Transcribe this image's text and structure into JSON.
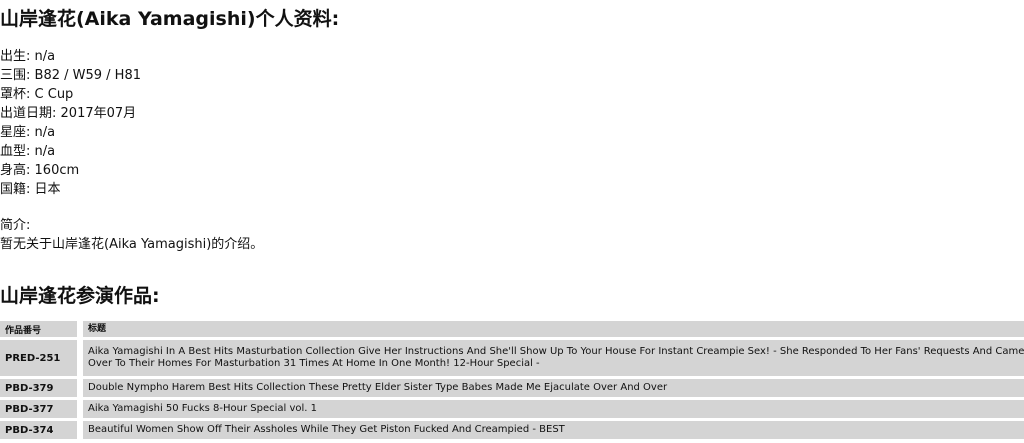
{
  "profile_title": "山岸逢花(Aika Yamagishi)个人资料:",
  "info": [
    {
      "label": "出生:",
      "value": "n/a"
    },
    {
      "label": "三围:",
      "value": "B82 / W59 / H81"
    },
    {
      "label": "罩杯:",
      "value": "C Cup"
    },
    {
      "label": "出道日期:",
      "value": "2017年07月"
    },
    {
      "label": "星座:",
      "value": "n/a"
    },
    {
      "label": "血型:",
      "value": "n/a"
    },
    {
      "label": "身高:",
      "value": "160cm"
    },
    {
      "label": "国籍:",
      "value": "日本"
    }
  ],
  "intro": {
    "label": "简介:",
    "text": "暂无关于山岸逢花(Aika Yamagishi)的介绍。"
  },
  "works_title": "山岸逢花参演作品:",
  "works_table": {
    "headers": [
      "作品番号",
      "标题"
    ],
    "rows": [
      {
        "id": "PRED-251",
        "title": "Aika Yamagishi In A Best Hits Masturbation Collection Give Her Instructions And She'll Show Up To Your House For Instant Creampie Sex! - She Responded To Her Fans' Requests And Came Over To Their Homes For Masturbation 31 Times At Home In One Month! 12-Hour Special -"
      },
      {
        "id": "PBD-379",
        "title": "Double Nympho Harem Best Hits Collection These Pretty Elder Sister Type Babes Made Me Ejaculate Over And Over"
      },
      {
        "id": "PBD-377",
        "title": "Aika Yamagishi 50 Fucks 8-Hour Special vol. 1"
      },
      {
        "id": "PBD-374",
        "title": "Beautiful Women Show Off Their Assholes While They Get Piston Fucked And Creampied - BEST"
      }
    ]
  }
}
